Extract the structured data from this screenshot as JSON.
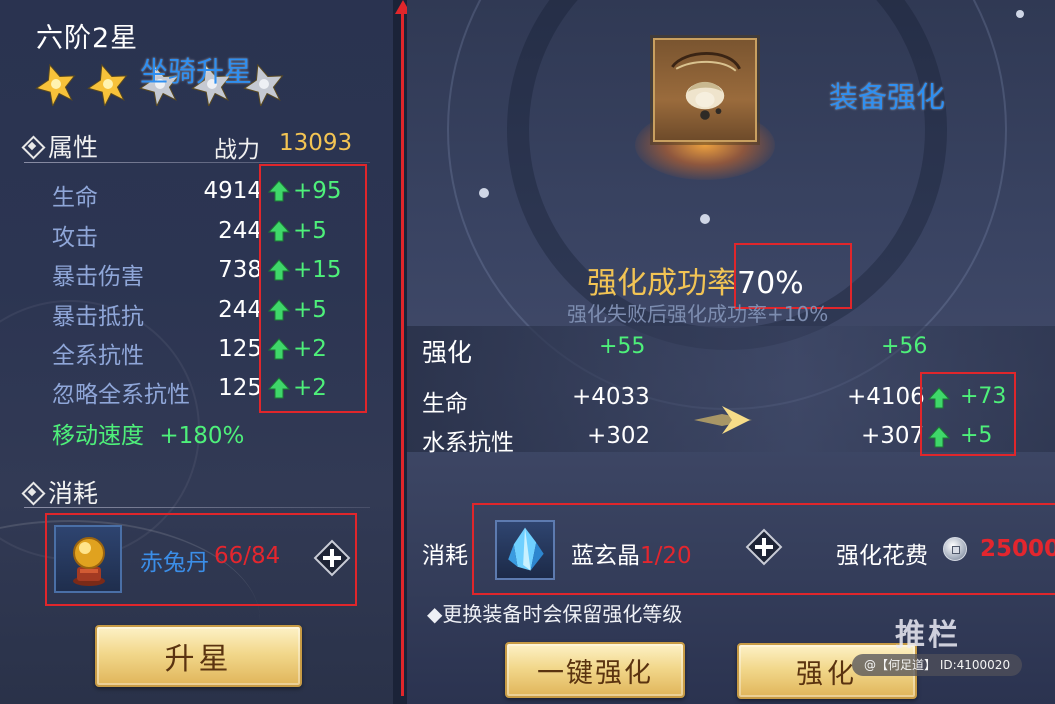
{
  "left_panel": {
    "rank_title": "六阶2星",
    "overlay_label": "坐骑升星",
    "stars": {
      "lit": 2,
      "total": 5,
      "lit_color": "#f7c23a",
      "dim_color": "#c5c9d2"
    },
    "attributes_title": "属性",
    "power_label": "战力",
    "power_value": "13093",
    "attributes": [
      {
        "name": "生命",
        "value": "4914",
        "increase": "+95"
      },
      {
        "name": "攻击",
        "value": "244",
        "increase": "+5"
      },
      {
        "name": "暴击伤害",
        "value": "738",
        "increase": "+15"
      },
      {
        "name": "暴击抵抗",
        "value": "244",
        "increase": "+5"
      },
      {
        "name": "全系抗性",
        "value": "125",
        "increase": "+2"
      },
      {
        "name": "忽略全系抗性",
        "value": "125",
        "increase": "+2"
      }
    ],
    "speed": {
      "name": "移动速度",
      "value": "+180%"
    },
    "consume_title": "消耗",
    "consume_item": {
      "name": "赤兔丹",
      "count": "66/84",
      "icon": "golden-orb-icon"
    },
    "upstar_button": "升星"
  },
  "right_panel": {
    "overlay_label": "装备强化",
    "equipment_icon": "necklace-icon",
    "success_rate_label": "强化成功率",
    "success_rate_value": "70%",
    "fail_note": "强化失败后强化成功率+10%",
    "enhance_title": "强化",
    "level_current": "+55",
    "level_next": "+56",
    "stats": [
      {
        "name": "生命",
        "current": "+4033",
        "next": "+4106",
        "increase": "+73"
      },
      {
        "name": "水系抗性",
        "current": "+302",
        "next": "+307",
        "increase": "+5"
      }
    ],
    "consume_label": "消耗",
    "material": {
      "name": "蓝玄晶",
      "count": "1/20",
      "icon": "blue-crystal-icon"
    },
    "cost_label": "强化花费",
    "cost_value": "25000",
    "note": "◆更换装备时会保留强化等级",
    "one_click_button": "一键强化",
    "enhance_button": "强化",
    "watermark": "推栏",
    "watermark_tag": "@【何足道】 ID:4100020"
  },
  "colors": {
    "highlight_red": "#e0262b",
    "increase_green": "#4ef07a",
    "gold_text": "#f3c453",
    "overlay_blue": "#2f8ff0"
  }
}
